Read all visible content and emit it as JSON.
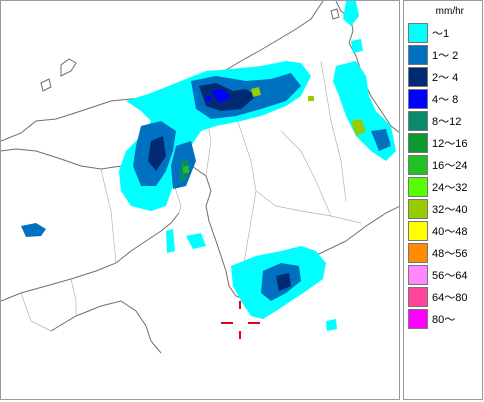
{
  "map": {
    "region": "Kinki / Chubu / Shikoku, Japan",
    "marker_color": "#e8001c",
    "coast_color": "#6e6e6e",
    "rain_cells": [
      {
        "level": 1,
        "color": "#00ffff"
      },
      {
        "level": 2,
        "color": "#0070c0"
      },
      {
        "level": 3,
        "color": "#002a72"
      },
      {
        "level": 4,
        "color": "#0000ff"
      },
      {
        "level": 5,
        "color": "#0a8a6a"
      },
      {
        "level": 7,
        "color": "#22c022"
      },
      {
        "level": 9,
        "color": "#99cc00"
      },
      {
        "level": 10,
        "color": "#ffff00"
      }
    ]
  },
  "legend": {
    "unit": "mm/hr",
    "items": [
      {
        "label": "～1",
        "color": "#00ffff"
      },
      {
        "label": "1～ 2",
        "color": "#0070c0"
      },
      {
        "label": "2～ 4",
        "color": "#002a72"
      },
      {
        "label": "4～ 8",
        "color": "#0000ff"
      },
      {
        "label": "8～12",
        "color": "#0a8a6a"
      },
      {
        "label": "12～16",
        "color": "#0c9a30"
      },
      {
        "label": "16～24",
        "color": "#22c022"
      },
      {
        "label": "24～32",
        "color": "#55ff00"
      },
      {
        "label": "32～40",
        "color": "#99cc00"
      },
      {
        "label": "40～48",
        "color": "#ffff00"
      },
      {
        "label": "48～56",
        "color": "#ff8c00"
      },
      {
        "label": "56～64",
        "color": "#ff88ff"
      },
      {
        "label": "64～80",
        "color": "#ff4499"
      },
      {
        "label": "80～",
        "color": "#ff00ff"
      }
    ]
  }
}
